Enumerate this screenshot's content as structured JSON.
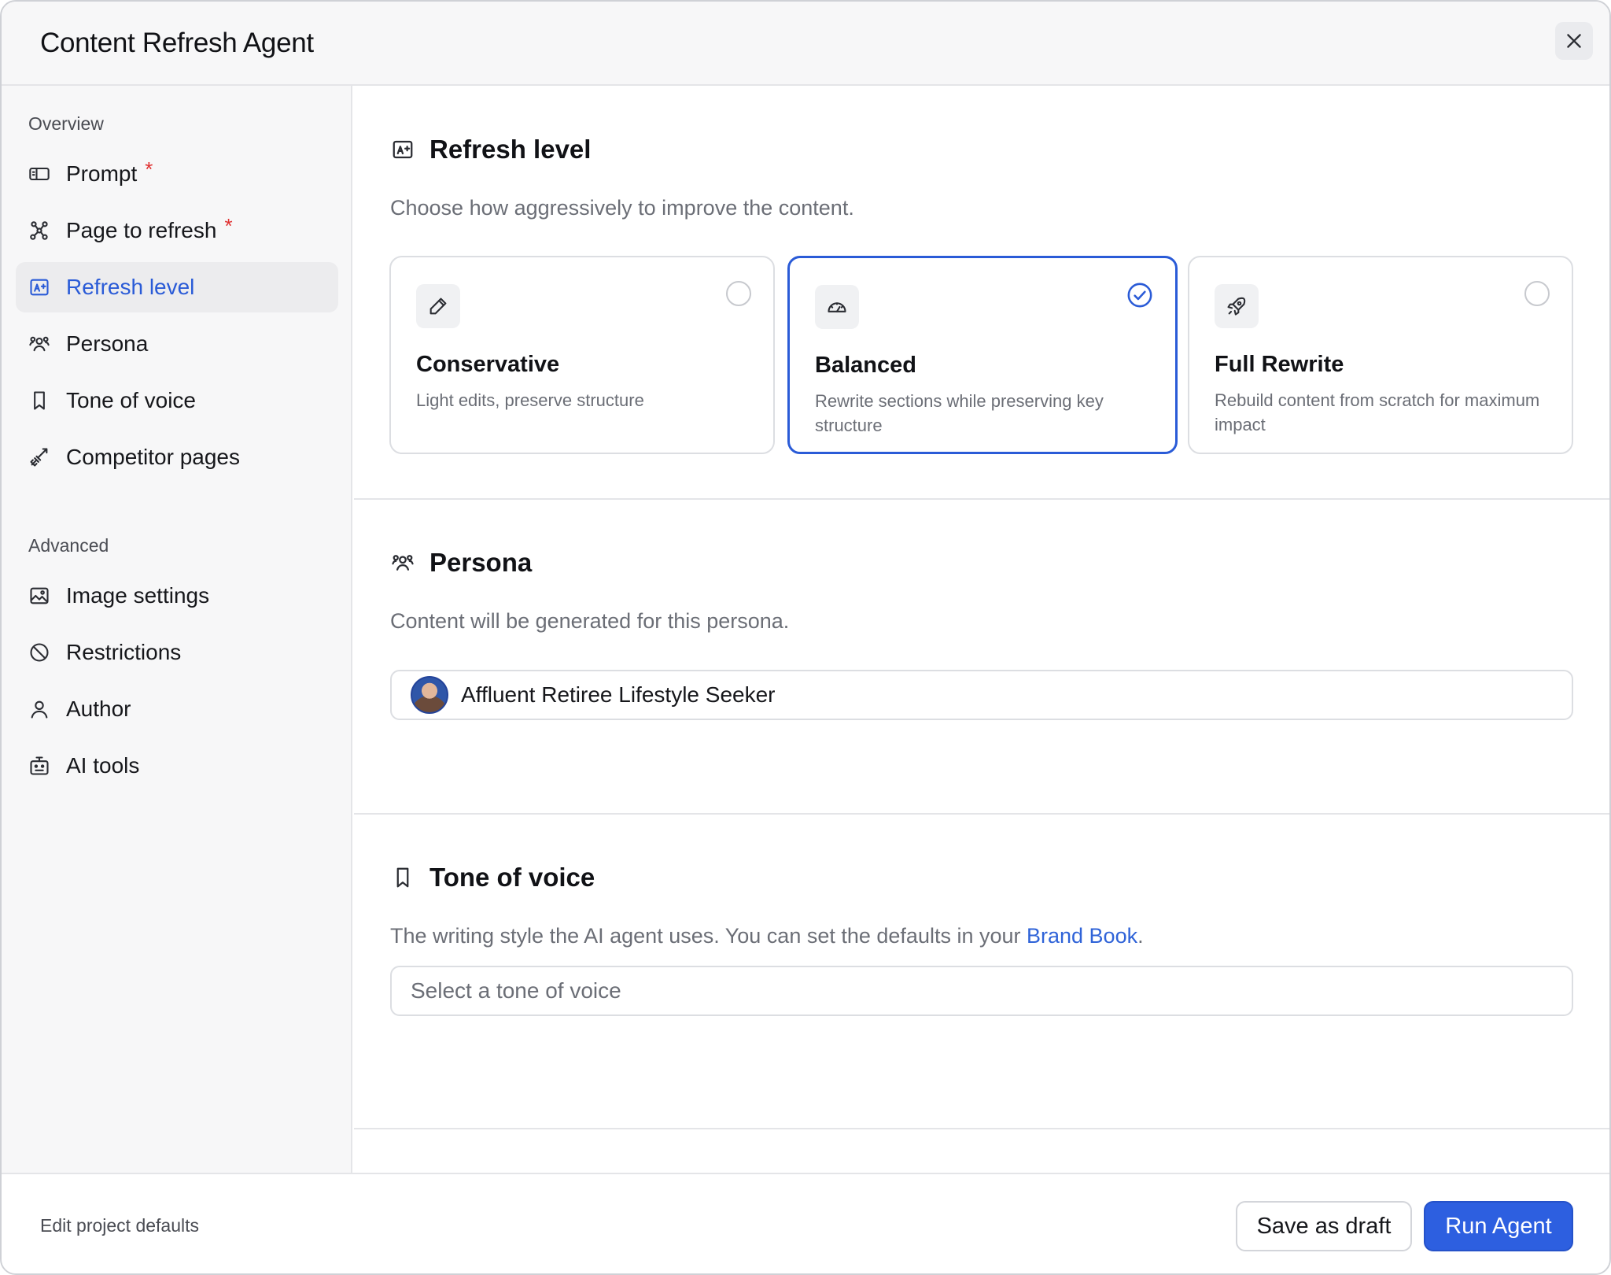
{
  "window": {
    "title": "Content Refresh Agent"
  },
  "sidebar": {
    "overview_label": "Overview",
    "advanced_label": "Advanced",
    "overview_items": [
      {
        "label": "Prompt",
        "required": "*",
        "icon": "prompt-icon"
      },
      {
        "label": "Page to refresh",
        "required": "*",
        "icon": "sitemap-icon"
      },
      {
        "label": "Refresh level",
        "active": true,
        "icon": "refresh-level-icon"
      },
      {
        "label": "Persona",
        "icon": "users-icon"
      },
      {
        "label": "Tone of voice",
        "icon": "bookmark-icon"
      },
      {
        "label": "Competitor pages",
        "icon": "swords-icon"
      }
    ],
    "advanced_items": [
      {
        "label": "Image settings",
        "icon": "image-icon"
      },
      {
        "label": "Restrictions",
        "icon": "ban-icon"
      },
      {
        "label": "Author",
        "icon": "user-icon"
      },
      {
        "label": "AI tools",
        "icon": "robot-icon"
      }
    ]
  },
  "refresh_level": {
    "title": "Refresh level",
    "description": "Choose how aggressively to improve the content.",
    "options": [
      {
        "title": "Conservative",
        "description": "Light edits, preserve structure",
        "icon": "pencil-icon",
        "selected": false
      },
      {
        "title": "Balanced",
        "description": "Rewrite sections while preserving key structure",
        "icon": "gauge-icon",
        "selected": true
      },
      {
        "title": "Full Rewrite",
        "description": "Rebuild content from scratch for maximum impact",
        "icon": "rocket-icon",
        "selected": false
      }
    ]
  },
  "persona": {
    "title": "Persona",
    "description": "Content will be generated for this persona.",
    "selected": "Affluent Retiree Lifestyle Seeker"
  },
  "tone_of_voice": {
    "title": "Tone of voice",
    "description_before": "The writing style the AI agent uses. You can set the defaults in your ",
    "link_text": "Brand Book",
    "description_after": ".",
    "placeholder": "Select a tone of voice"
  },
  "footer": {
    "edit_defaults": "Edit project defaults",
    "save_draft": "Save as draft",
    "run_agent": "Run Agent"
  },
  "colors": {
    "accent": "#2d5fe0",
    "required": "#e03131",
    "link": "#2f63d8"
  }
}
